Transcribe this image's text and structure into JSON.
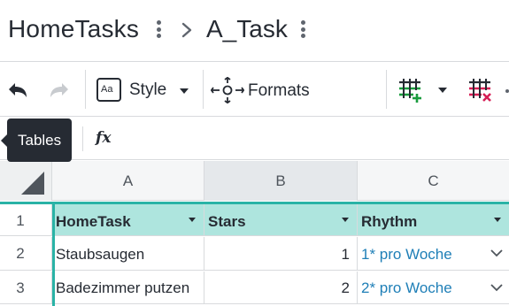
{
  "breadcrumb": {
    "document_title": "HomeTasks",
    "page_title": "A_Task"
  },
  "toolbar": {
    "style_icon_text": "Aa",
    "style_label": "Style",
    "formats_label": "Formats"
  },
  "formula_bar": {
    "fx_label": "fx",
    "tooltip": "Tables"
  },
  "grid": {
    "column_letters": [
      "A",
      "B",
      "C"
    ],
    "row_numbers": [
      "1",
      "2",
      "3"
    ],
    "table_headers": [
      "HomeTask",
      "Stars",
      "Rhythm"
    ],
    "rows": [
      {
        "hometask": "Staubsaugen",
        "stars": "1",
        "rhythm": "1* pro Woche"
      },
      {
        "hometask": "Badezimmer putzen",
        "stars": "2",
        "rhythm": "2* pro Woche"
      }
    ]
  },
  "colors": {
    "table_header_bg": "#aee5de",
    "table_accent": "#2ab3a6",
    "link_text": "#1f7fb7",
    "insert_icon": "#1a9c3e",
    "delete_icon": "#d61f55",
    "tooltip_bg": "#262b33"
  }
}
